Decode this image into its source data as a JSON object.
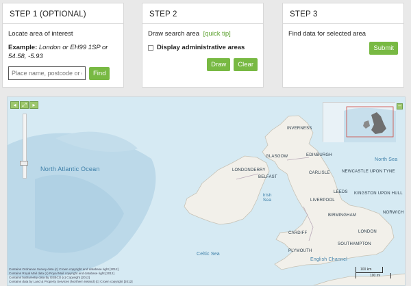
{
  "step1": {
    "title": "STEP 1 (OPTIONAL)",
    "heading": "Locate area of interest",
    "example_label": "Example:",
    "example_text": "London or EH99 1SP or 54.58, -5.93",
    "search_placeholder": "Place name, postcode or c",
    "find_label": "Find"
  },
  "step2": {
    "title": "STEP 2",
    "heading": "Draw search area",
    "quick_tip": "[quick tip]",
    "checkbox_label": "Display administrative areas",
    "draw_label": "Draw",
    "clear_label": "Clear"
  },
  "step3": {
    "title": "STEP 3",
    "heading": "Find data for selected area",
    "submit_label": "Submit"
  },
  "map": {
    "labels": {
      "north_atlantic": "North Atlantic Ocean",
      "north_sea": "North Sea",
      "irish_sea": "Irish Sea",
      "celtic_sea": "Celtic Sea",
      "english_channel": "English Channel",
      "inverness": "INVERNESS",
      "glasgow": "GLASGOW",
      "edinburgh": "EDINBURGH",
      "londonderry": "LONDONDERRY",
      "belfast": "BELFAST",
      "newcastle": "NEWCASTLE UPON TYNE",
      "carlisle": "CARLISLE",
      "leeds": "LEEDS",
      "kingston": "KINGSTON UPON HULL",
      "liverpool": "LIVERPOOL",
      "birmingham": "BIRMINGHAM",
      "norwich": "NORWICH",
      "cardiff": "CARDIFF",
      "london": "LONDON",
      "southampton": "SOUTHAMPTON",
      "plymouth": "PLYMOUTH"
    },
    "copyright": [
      "Contains Ordnance Survey data (c) Crown copyright and database right [2012]",
      "Contains Royal Mail data (c) Royal Mail copyright and database right [2012]",
      "Contains bathymetry data by GEBCO (c) Copyright [2012]",
      "Contains data by Land & Property Services (Northern Ireland) (c) Crown copyright [2012]"
    ],
    "scale_km": "100 km",
    "scale_mi": "100 mi"
  },
  "colors": {
    "accent": "#78b943",
    "sea": "#cfe6f0",
    "land": "#f2f0ea"
  }
}
